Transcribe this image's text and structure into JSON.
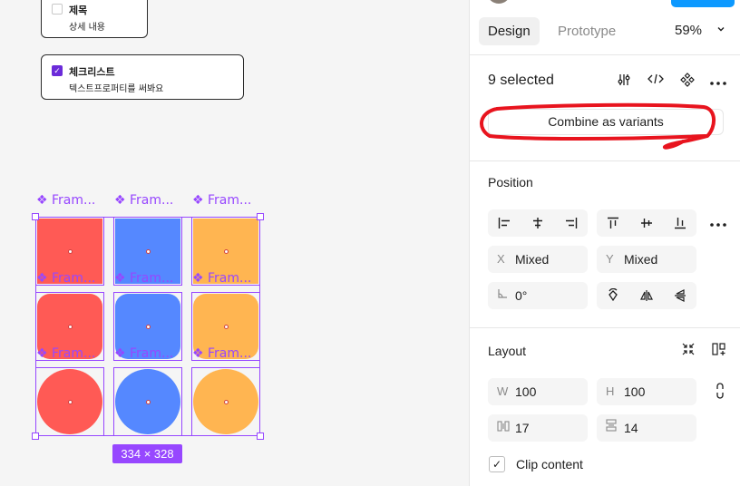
{
  "canvas": {
    "card1": {
      "title": "제목",
      "subtitle": "상세 내용"
    },
    "card2": {
      "title": "체크리스트",
      "subtitle": "텍스트프로퍼티를 써봐요"
    },
    "frame_label": "❖ Fram...",
    "frame_label_inner": "❖ Fram...",
    "size_badge": "334 × 328",
    "colors": {
      "red": "#ff5a55",
      "blue": "#5588ff",
      "orange": "#ffb551",
      "selection": "#9747ff"
    },
    "grid": {
      "rows": [
        [
          "red-square",
          "blue-square",
          "orange-square"
        ],
        [
          "red-rounded",
          "blue-rounded",
          "orange-rounded"
        ],
        [
          "red-circle",
          "blue-circle",
          "orange-circle"
        ]
      ]
    }
  },
  "panel": {
    "tabs": {
      "design": "Design",
      "prototype": "Prototype"
    },
    "zoom": "59%",
    "selection": {
      "label": "9 selected"
    },
    "combine_button": "Combine as variants",
    "position": {
      "title": "Position",
      "x_label": "X",
      "x_value": "Mixed",
      "y_label": "Y",
      "y_value": "Mixed",
      "rotation": "0°"
    },
    "layout": {
      "title": "Layout",
      "w_label": "W",
      "w_value": "100",
      "h_label": "H",
      "h_value": "100",
      "gap_h": "17",
      "gap_v": "14"
    },
    "clip_content": "Clip content"
  }
}
